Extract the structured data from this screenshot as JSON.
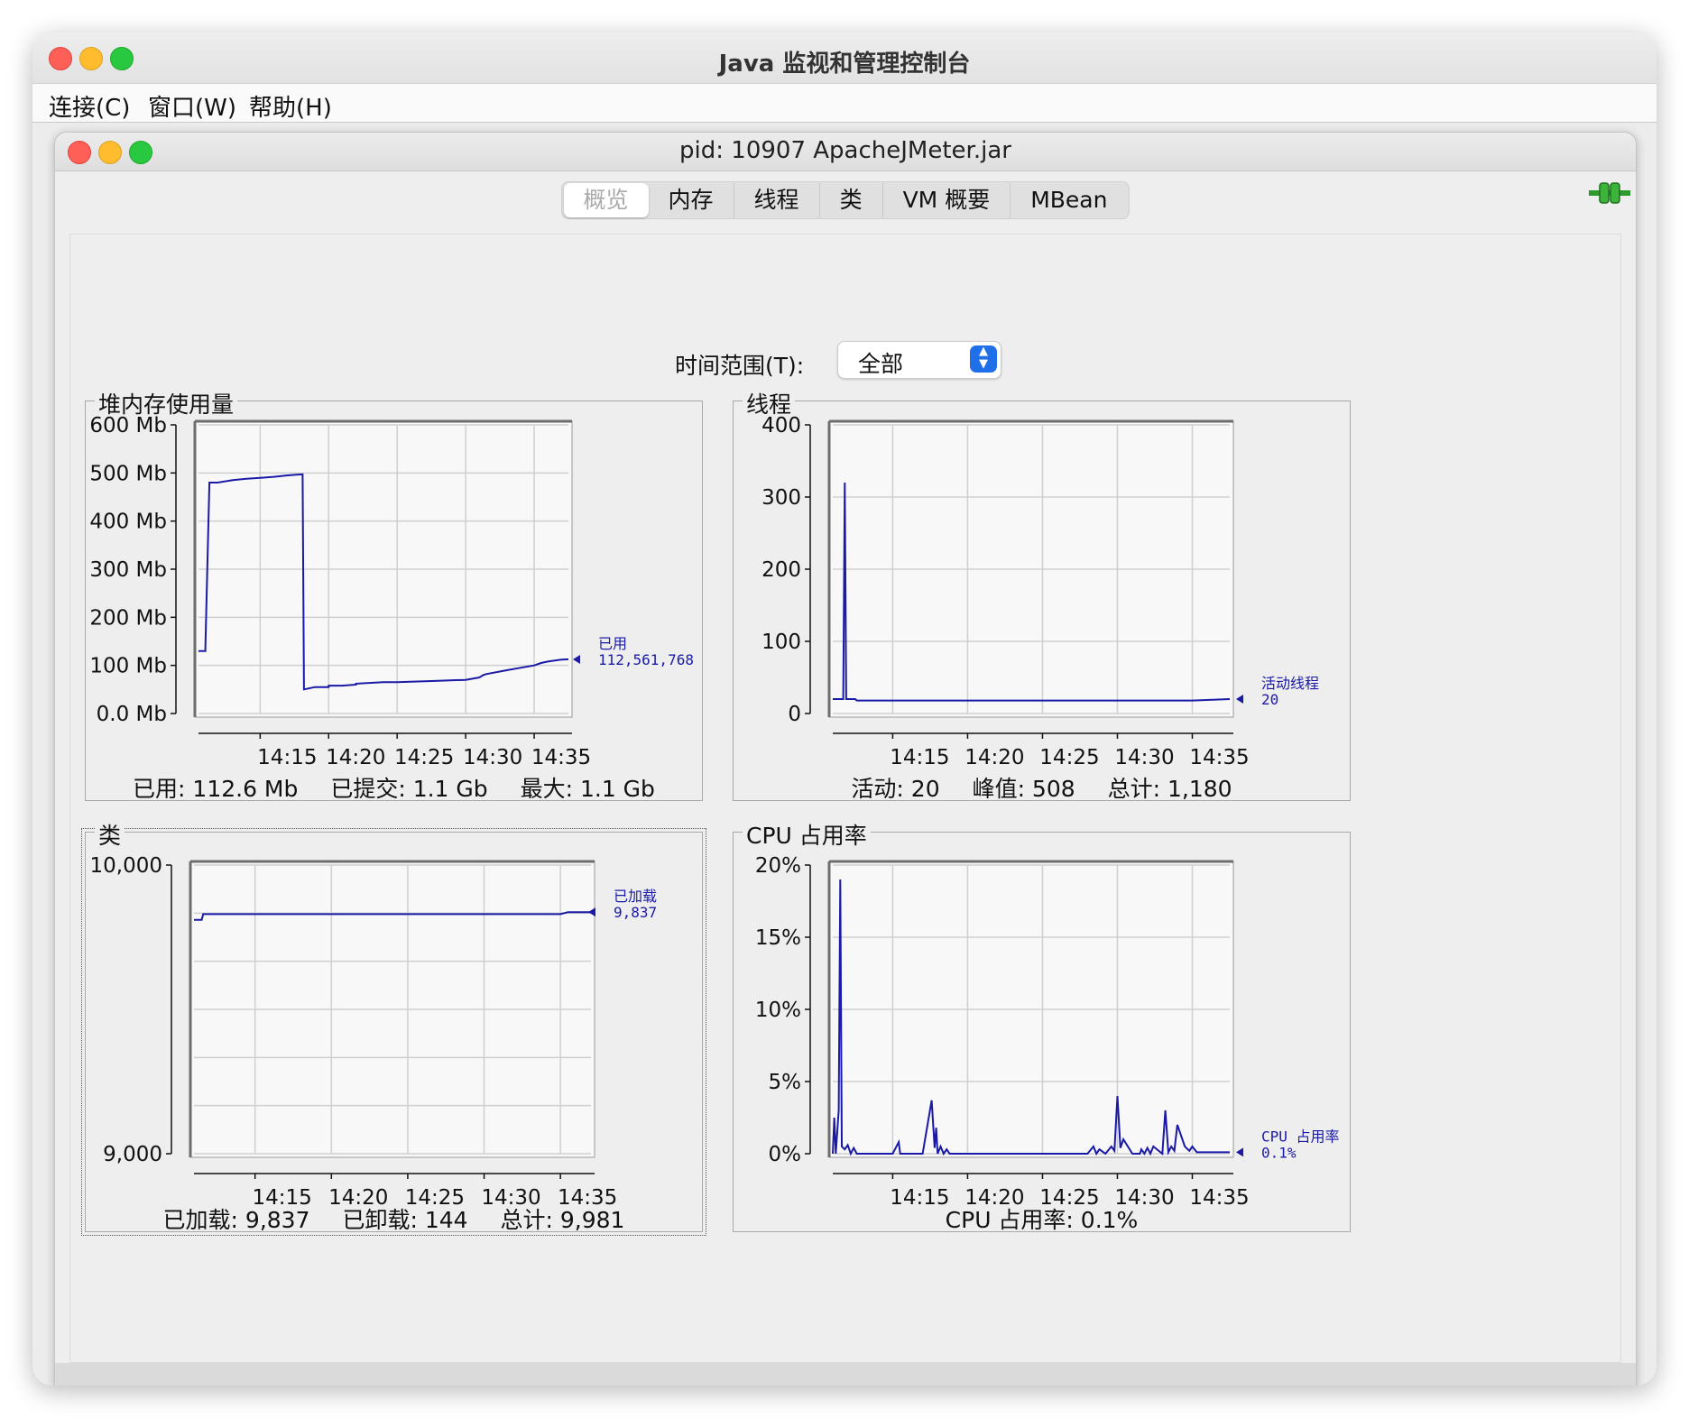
{
  "window": {
    "title": "Java 监视和管理控制台",
    "menu": [
      "连接(C)",
      "窗口(W)",
      "帮助(H)"
    ]
  },
  "inner_window": {
    "title": "pid: 10907 ApacheJMeter.jar",
    "tabs": [
      "概览",
      "内存",
      "线程",
      "类",
      "VM 概要",
      "MBean"
    ],
    "selected_tab": "概览"
  },
  "time_range": {
    "label": "时间范围(T):",
    "value": "全部"
  },
  "colors": {
    "series": "#1a1aa6",
    "grid": "#cfcfcf",
    "plot_bg": "#f8f8f8"
  },
  "panels": {
    "heap": {
      "title": "堆内存使用量",
      "stats": [
        "已用: 112.6 Mb",
        "已提交: 1.1 Gb",
        "最大: 1.1 Gb"
      ],
      "legend": {
        "name": "已用",
        "value": "112,561,768"
      }
    },
    "threads": {
      "title": "线程",
      "stats": [
        "活动: 20",
        "峰值: 508",
        "总计: 1,180"
      ],
      "legend": {
        "name": "活动线程",
        "value": "20"
      }
    },
    "classes": {
      "title": "类",
      "stats": [
        "已加载: 9,837",
        "已卸载: 144",
        "总计: 9,981"
      ],
      "legend": {
        "name": "已加载",
        "value": "9,837"
      }
    },
    "cpu": {
      "title": "CPU 占用率",
      "stats": [
        "CPU 占用率: 0.1%"
      ],
      "legend": {
        "name": "CPU 占用率",
        "value": "0.1%"
      }
    }
  },
  "chart_data": [
    {
      "id": "heap",
      "type": "line",
      "ylim": [
        0,
        600
      ],
      "yticks": [
        0,
        100,
        200,
        300,
        400,
        500,
        600
      ],
      "ytick_labels": [
        "0.0 Mb",
        "100 Mb",
        "200 Mb",
        "300 Mb",
        "400 Mb",
        "500 Mb",
        "600 Mb"
      ],
      "xlim": [
        10.5,
        37.5
      ],
      "xticks": [
        15,
        20,
        25,
        30,
        35
      ],
      "xtick_labels": [
        "14:15",
        "14:20",
        "14:25",
        "14:30",
        "14:35"
      ],
      "series": [
        {
          "name": "已用",
          "x": [
            10.5,
            11,
            11,
            11.3,
            11.5,
            11.9,
            13,
            13,
            14,
            14,
            15,
            15,
            16,
            16,
            17,
            17,
            18,
            18,
            18.1,
            18.2,
            19,
            20,
            20,
            21,
            22,
            22,
            24,
            25,
            28,
            30,
            31,
            31.3,
            31.5,
            33,
            34,
            35,
            35.5,
            36,
            36.5,
            37,
            37.5
          ],
          "y": [
            130,
            130,
            135,
            480,
            480,
            480,
            485,
            485,
            488,
            488,
            490,
            490,
            492,
            492,
            495,
            495,
            497,
            497,
            497,
            50,
            55,
            55,
            58,
            58,
            60,
            62,
            65,
            65,
            68,
            70,
            75,
            80,
            82,
            90,
            95,
            100,
            105,
            108,
            110,
            112,
            112.6
          ]
        }
      ]
    },
    {
      "id": "threads",
      "type": "line",
      "ylim": [
        0,
        400
      ],
      "yticks": [
        0,
        100,
        200,
        300,
        400
      ],
      "ytick_labels": [
        "0",
        "100",
        "200",
        "300",
        "400"
      ],
      "xlim": [
        11,
        37.5
      ],
      "xticks": [
        15,
        20,
        25,
        30,
        35
      ],
      "xtick_labels": [
        "14:15",
        "14:20",
        "14:25",
        "14:30",
        "14:35"
      ],
      "series": [
        {
          "name": "活动线程",
          "x": [
            11,
            11.5,
            11.7,
            11.8,
            11.9,
            12.5,
            12.6,
            15,
            20,
            25,
            30,
            35,
            37.5
          ],
          "y": [
            20,
            20,
            20,
            320,
            20,
            20,
            18,
            18,
            18,
            18,
            18,
            18,
            20
          ]
        }
      ]
    },
    {
      "id": "classes",
      "type": "line",
      "ylim": [
        9000,
        10000
      ],
      "yticks": [
        9000,
        10000
      ],
      "ytick_labels": [
        "9,000",
        "10,000"
      ],
      "xlim": [
        11,
        37
      ],
      "xticks": [
        15,
        20,
        25,
        30,
        35
      ],
      "xtick_labels": [
        "14:15",
        "14:20",
        "14:25",
        "14:30",
        "14:35"
      ],
      "series": [
        {
          "name": "已加载",
          "x": [
            11,
            11.5,
            11.6,
            12,
            15,
            20,
            25,
            30,
            35,
            35.5,
            36,
            37
          ],
          "y": [
            9810,
            9810,
            9830,
            9830,
            9830,
            9830,
            9830,
            9830,
            9830,
            9837,
            9837,
            9837
          ]
        }
      ]
    },
    {
      "id": "cpu",
      "type": "line",
      "ylim": [
        0,
        20
      ],
      "yticks": [
        0,
        5,
        10,
        15,
        20
      ],
      "ytick_labels": [
        "0%",
        "5%",
        "10%",
        "15%",
        "20%"
      ],
      "xlim": [
        11,
        37.5
      ],
      "xticks": [
        15,
        20,
        25,
        30,
        35
      ],
      "xtick_labels": [
        "14:15",
        "14:20",
        "14:25",
        "14:30",
        "14:35"
      ],
      "series": [
        {
          "name": "CPU 占用率",
          "x": [
            11,
            11.1,
            11.2,
            11.4,
            11.5,
            11.6,
            11.8,
            12,
            12.2,
            12.4,
            12.6,
            13,
            15,
            15.4,
            15.5,
            15.6,
            17,
            17.6,
            17.8,
            17.9,
            18,
            18.2,
            18.4,
            18.6,
            18.8,
            19,
            20,
            25,
            28,
            28.4,
            28.6,
            28.8,
            29.2,
            29.6,
            29.8,
            30,
            30.2,
            30.4,
            31,
            31.5,
            31.6,
            31.8,
            32,
            32.2,
            32.4,
            33,
            33.2,
            33.4,
            33.6,
            33.8,
            34,
            34.5,
            34.8,
            35,
            35.3,
            35.5,
            36,
            37,
            37.5
          ],
          "y": [
            0,
            2.5,
            0,
            3,
            19,
            0.5,
            0.3,
            0.6,
            0,
            0.4,
            0,
            0,
            0,
            0.8,
            0,
            0,
            0,
            3.7,
            0.4,
            1.8,
            0,
            0.5,
            0,
            0.3,
            0,
            0,
            0,
            0,
            0,
            0.5,
            0,
            0.3,
            0,
            0.5,
            0.2,
            4,
            0.4,
            1,
            0,
            0,
            0.3,
            0,
            0.4,
            0,
            0.5,
            0,
            3,
            0.1,
            0.5,
            0.2,
            2,
            0.5,
            0.2,
            0.5,
            0.1,
            0.1,
            0.1,
            0.1,
            0.1
          ]
        }
      ]
    }
  ]
}
